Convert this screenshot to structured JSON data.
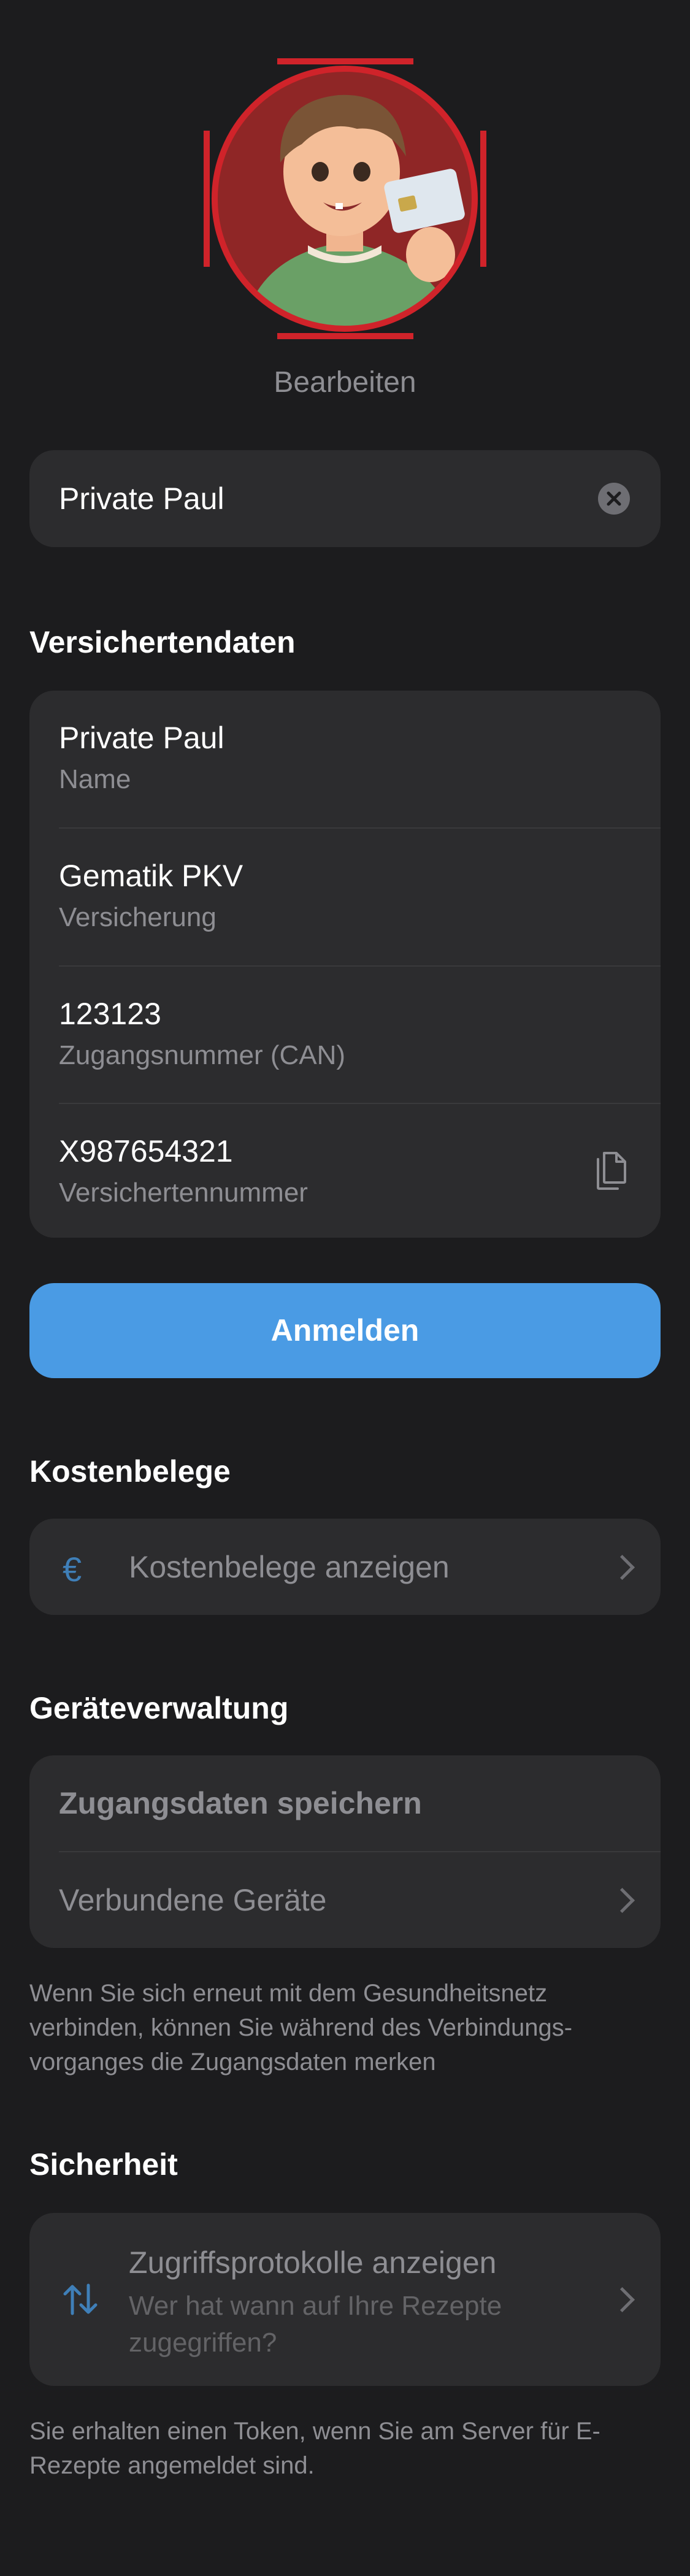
{
  "profile": {
    "avatar_icon": "profile-avatar-illustration",
    "edit_label": "Bearbeiten"
  },
  "name_field": {
    "value": "Private Paul",
    "clear_icon": "clear-circle-icon"
  },
  "insured_data": {
    "title": "Versichertendaten",
    "rows": [
      {
        "value": "Private Paul",
        "label": "Name"
      },
      {
        "value": "Gematik PKV",
        "label": "Versicherung"
      },
      {
        "value": "123123",
        "label": "Zugangsnummer (CAN)"
      },
      {
        "value": "X987654321",
        "label": "Versichertennummer"
      }
    ],
    "copy_icon": "copy-icon"
  },
  "login_button": "Anmelden",
  "receipts": {
    "title": "Kostenbelege",
    "item_label": "Kostenbelege anzeigen",
    "item_icon": "euro-icon"
  },
  "devices": {
    "title": "Geräteverwaltung",
    "save_label": "Zugangsdaten speichern",
    "connected_label": "Verbundene Geräte",
    "footnote": "Wenn Sie sich erneut mit dem Gesundheitsnetz verbinden, können Sie während des Verbindungs-vorganges die Zugangsdaten merken"
  },
  "security": {
    "title": "Sicherheit",
    "item_title": "Zugriffsprotokolle anzeigen",
    "item_subtitle": "Wer hat wann auf Ihre Rezepte zugegriffen?",
    "item_icon": "arrows-up-down-icon",
    "footnote": "Sie erhalten einen Token, wenn Sie am Server für E-Rezepte angemeldet sind."
  },
  "colors": {
    "background": "#1c1c1e",
    "card": "#2c2c2e",
    "accent": "#4a9be4",
    "selection": "#d0232a"
  }
}
